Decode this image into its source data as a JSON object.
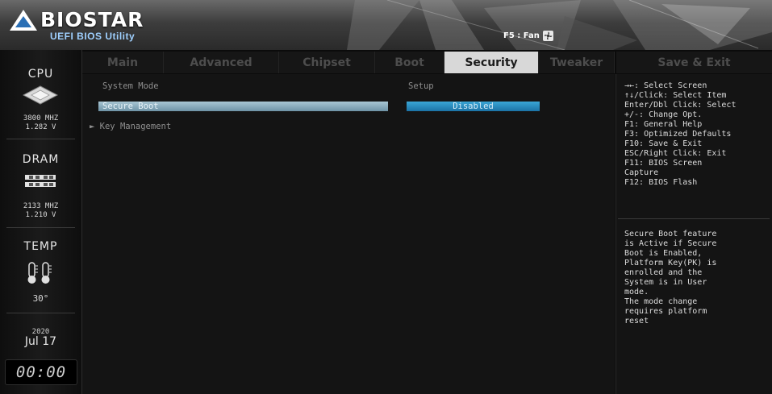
{
  "header": {
    "brand": "BIOSTAR",
    "subtitle": "UEFI BIOS Utility",
    "fan_hint": "F5 : Fan"
  },
  "tabs": [
    {
      "label": "Main",
      "active": false
    },
    {
      "label": "Advanced",
      "active": false
    },
    {
      "label": "Chipset",
      "active": false
    },
    {
      "label": "Boot",
      "active": false
    },
    {
      "label": "Security",
      "active": true
    },
    {
      "label": "Tweaker",
      "active": false
    }
  ],
  "save_exit_tab": "Save & Exit",
  "status": {
    "cpu_title": "CPU",
    "cpu_freq": "3800 MHZ",
    "cpu_volt": "1.282 V",
    "dram_title": "DRAM",
    "dram_freq": "2133 MHZ",
    "dram_volt": "1.210 V",
    "temp_title": "TEMP",
    "temp_value": "30°",
    "year": "2020",
    "month_day": "Jul 17",
    "clock": "00:00"
  },
  "main": {
    "system_mode_label": "System Mode",
    "system_mode_value": "Setup",
    "secure_boot_label": "Secure Boot",
    "secure_boot_value": "Disabled",
    "key_management_label": "Key Management"
  },
  "help": {
    "keys": [
      "→←: Select Screen",
      "↑↓/Click: Select Item",
      "Enter/Dbl Click: Select",
      "+/-: Change Opt.",
      "F1: General Help",
      "F3: Optimized Defaults",
      "F10: Save & Exit",
      "ESC/Right Click: Exit",
      "F11: BIOS Screen",
      "Capture",
      "F12: BIOS Flash"
    ],
    "description": [
      "Secure Boot feature",
      "is Active if Secure",
      "Boot is Enabled,",
      "Platform Key(PK) is",
      "enrolled and the",
      "System is in User",
      "mode.",
      "The mode change",
      "requires platform",
      "reset"
    ]
  },
  "colors": {
    "active_tab": "#d8d8d8",
    "highlight": "#8fb3c5",
    "value_box": "#2a8cc0"
  }
}
